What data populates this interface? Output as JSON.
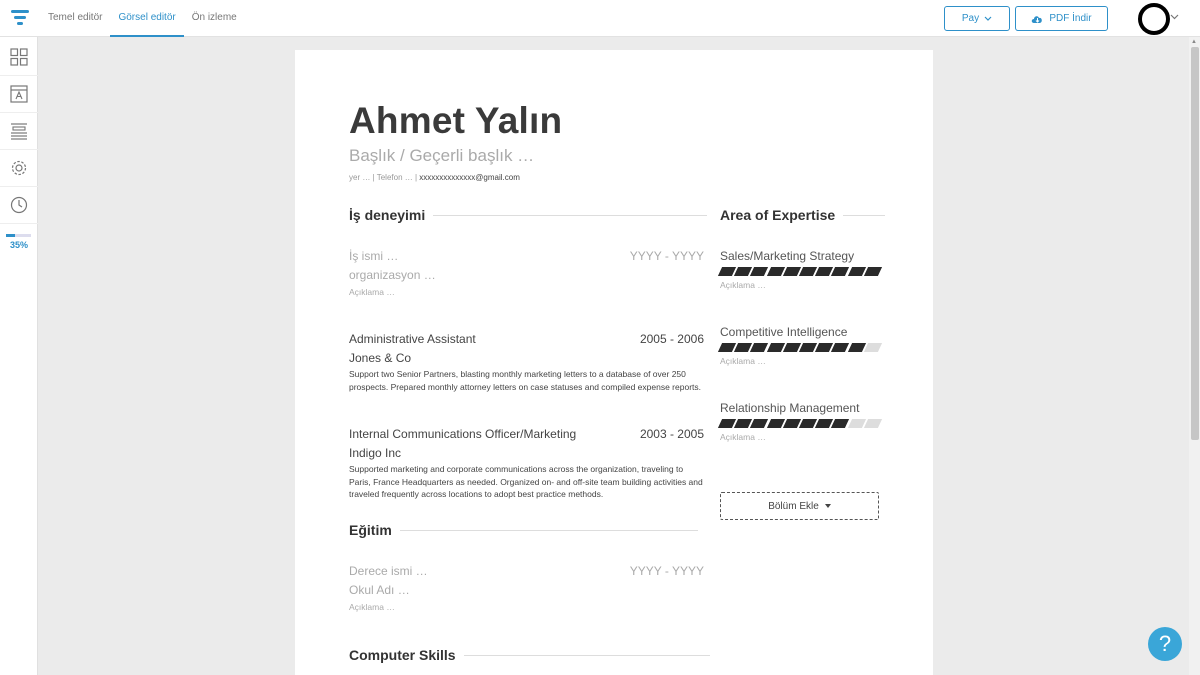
{
  "topbar": {
    "tabs": [
      "Temel editör",
      "Görsel editör",
      "Ön izleme"
    ],
    "active_tab": "Görsel editör",
    "share_label": "Pay",
    "pdf_label": "PDF İndir"
  },
  "sidebar": {
    "items": [
      "grid-icon",
      "template-icon",
      "layout-icon",
      "gear-icon",
      "history-icon"
    ],
    "progress": 35,
    "progress_label": "35%"
  },
  "resume": {
    "name": "Ahmet Yalın",
    "subtitle": "Başlık / Geçerli başlık …",
    "contact": {
      "location": "yer …",
      "sep1": " | ",
      "phone": "Telefon …",
      "sep2": " | ",
      "email": "xxxxxxxxxxxxxx@gmail.com"
    },
    "experience": {
      "heading": "İş deneyimi",
      "jobs": [
        {
          "title": "İş ismi …",
          "date": "YYYY - YYYY",
          "org": "organizasyon …",
          "desc": "Açıklama …",
          "placeholder": true
        },
        {
          "title": "Administrative Assistant",
          "date": "2005 - 2006",
          "org": "Jones & Co",
          "desc": "Support two Senior Partners, blasting monthly marketing letters to a database of over 250 prospects. Prepared monthly attorney letters on case statuses and compiled expense reports.",
          "placeholder": false
        },
        {
          "title": "Internal Communications Officer/Marketing",
          "date": "2003 - 2005",
          "org": "Indigo Inc",
          "desc": "Supported marketing and corporate communications across the organization, traveling to Paris, France Headquarters as needed. Organized on- and off-site team building activities and traveled frequently across locations to adopt best practice methods.",
          "placeholder": false
        }
      ]
    },
    "education": {
      "heading": "Eğitim",
      "items": [
        {
          "title": "Derece ismi …",
          "date": "YYYY - YYYY",
          "org": "Okul Adı …",
          "desc": "Açıklama …"
        }
      ]
    },
    "computer_skills": {
      "heading": "Computer Skills"
    },
    "expertise": {
      "heading": "Area of Expertise",
      "skills": [
        {
          "name": "Sales/Marketing Strategy",
          "level": 10,
          "max": 10,
          "desc": "Açıklama …"
        },
        {
          "name": "Competitive Intelligence",
          "level": 9,
          "max": 10,
          "desc": "Açıklama …"
        },
        {
          "name": "Relationship Management",
          "level": 8,
          "max": 10,
          "desc": "Açıklama …"
        }
      ]
    },
    "add_section_label": "Bölüm Ekle"
  },
  "help_label": "?"
}
